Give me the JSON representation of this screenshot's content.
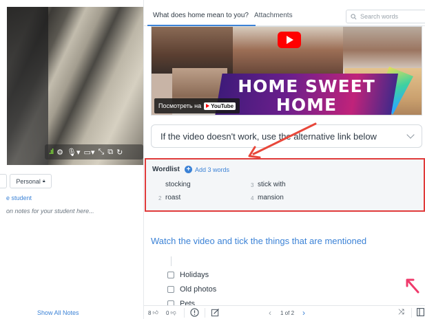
{
  "sidebar": {
    "personal_chip": "Personal",
    "student_link": "e student",
    "notes_placeholder": "on notes for your student here...",
    "show_all_notes": "Show All Notes"
  },
  "tabs": [
    {
      "label": "What does home mean to you?",
      "active": true
    },
    {
      "label": "Attachments",
      "active": false
    }
  ],
  "search": {
    "placeholder": "Search words"
  },
  "video": {
    "title_line1": "HOME SWEET",
    "title_line2": "HOME",
    "watch_on": "Посмотреть на",
    "youtube_label": "YouTube"
  },
  "alternative_link": {
    "text": "If the video doesn't work, use the alternative link below"
  },
  "wordlist": {
    "title": "Wordlist",
    "add_label": "Add 3 words",
    "words": [
      {
        "num": "",
        "text": "stocking"
      },
      {
        "num": "2",
        "text": "roast"
      },
      {
        "num": "3",
        "text": "stick with"
      },
      {
        "num": "4",
        "text": "mansion"
      }
    ]
  },
  "task": {
    "title": "Watch the video and tick the things that are mentioned",
    "items": [
      "Holidays",
      "Old photos",
      "Pets"
    ]
  },
  "bottom_bar": {
    "likes": "8",
    "dislikes": "0",
    "pager": "1 of 2"
  },
  "colors": {
    "accent": "#3b82d6",
    "highlight_border": "#e03a3a",
    "annotation_arrow": "#e8473a",
    "pink_arrow": "#ef3a6b"
  }
}
